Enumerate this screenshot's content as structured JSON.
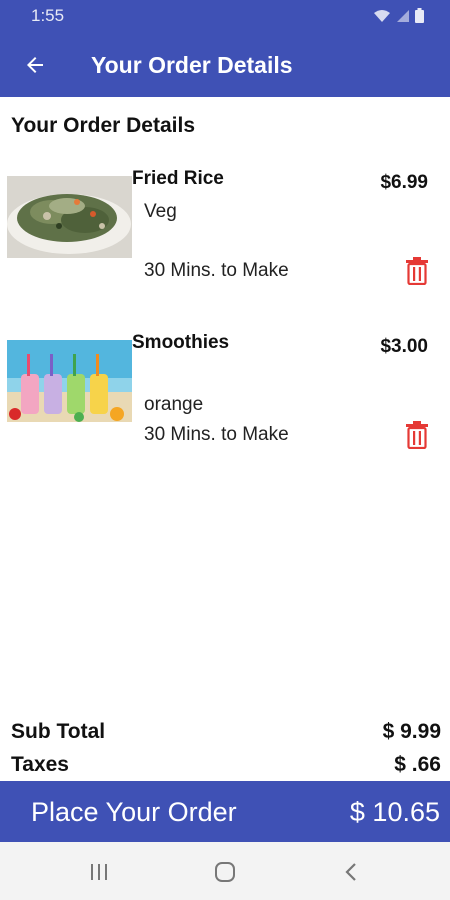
{
  "status_bar": {
    "time": "1:55"
  },
  "app_bar": {
    "title": "Your Order Details",
    "back_icon": "arrow-left-icon"
  },
  "section_title": "Your Order Details",
  "items": [
    {
      "name": "Fried Rice",
      "price": "$6.99",
      "variant": "Veg",
      "prep_time": "30 Mins. to Make",
      "image": "fried-rice-photo"
    },
    {
      "name": "Smoothies",
      "price": "$3.00",
      "variant": "orange",
      "prep_time": "30 Mins. to Make",
      "image": "smoothies-photo"
    }
  ],
  "summary": {
    "subtotal_label": "Sub Total",
    "subtotal_value": "$ 9.99",
    "taxes_label": "Taxes",
    "taxes_value": "$ .66"
  },
  "place_order": {
    "label": "Place Your Order",
    "total": "$ 10.65"
  },
  "colors": {
    "primary": "#3f51b5",
    "delete": "#e53935",
    "nav_bg": "#f3f3f3"
  }
}
